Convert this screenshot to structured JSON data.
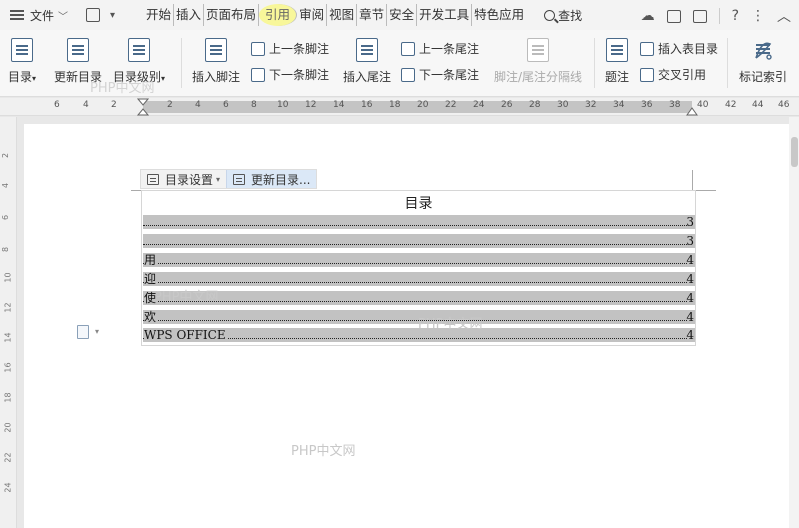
{
  "menubar": {
    "file_label": "文件",
    "tabs": [
      "开始",
      "插入",
      "页面布局",
      "引用",
      "审阅",
      "视图",
      "章节",
      "安全",
      "开发工具",
      "特色应用"
    ],
    "active_tab_index": 3,
    "search_label": "查找"
  },
  "ribbon": {
    "toc": "目录",
    "update_toc": "更新目录",
    "toc_level": "目录级别",
    "insert_footnote": "插入脚注",
    "prev_footnote": "上一条脚注",
    "next_footnote": "下一条脚注",
    "insert_endnote": "插入尾注",
    "prev_endnote": "上一条尾注",
    "next_endnote": "下一条尾注",
    "separator_line": "脚注/尾注分隔线",
    "caption": "题注",
    "insert_table_toc": "插入表目录",
    "cross_ref": "交叉引用",
    "mark_index": "标记索引"
  },
  "ruler": {
    "left_numbers": [
      "6",
      "4",
      "2"
    ],
    "right_numbers": [
      "2",
      "4",
      "6",
      "8",
      "10",
      "12",
      "14",
      "16",
      "18",
      "20",
      "22",
      "24",
      "26",
      "28",
      "30",
      "32",
      "34",
      "36",
      "38",
      "40",
      "42",
      "44",
      "46"
    ]
  },
  "vruler_numbers": [
    "2",
    "4",
    "6",
    "8",
    "10",
    "12",
    "14",
    "16",
    "18",
    "20",
    "22",
    "24"
  ],
  "toc_toolbar": {
    "settings_label": "目录设置",
    "update_label": "更新目录..."
  },
  "toc": {
    "title": "目录",
    "entries": [
      {
        "text": "",
        "page": "3"
      },
      {
        "text": "",
        "page": "3"
      },
      {
        "text": "用",
        "page": "4"
      },
      {
        "text": "迎",
        "page": "4"
      },
      {
        "text": "使",
        "page": "4"
      },
      {
        "text": "欢",
        "page": "4"
      },
      {
        "text": "WPS OFFICE",
        "page": "4"
      }
    ]
  },
  "watermarks": {
    "ribbon": "PHP中文网",
    "doc1": "PHP中文网",
    "doc2": "PHP中文网",
    "doc3": "PHP中文网"
  }
}
